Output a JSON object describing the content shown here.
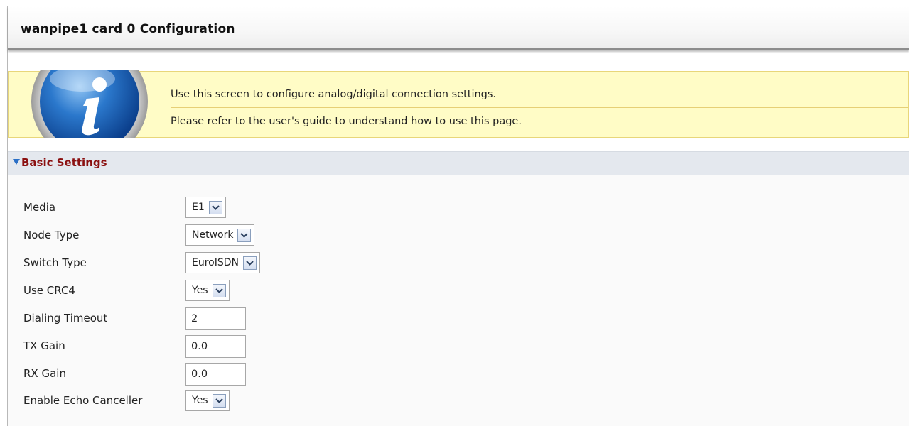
{
  "page": {
    "title": "wanpipe1 card 0 Configuration"
  },
  "info": {
    "icon": "info-icon",
    "line1": "Use this screen to configure analog/digital connection settings.",
    "line2": "Please refer to the user's guide to understand how to use this page."
  },
  "section": {
    "title": "Basic Settings",
    "icon": "triangle-down-icon",
    "accent": "#8b1010"
  },
  "fields": {
    "media": {
      "label": "Media",
      "value": "E1"
    },
    "node_type": {
      "label": "Node Type",
      "value": "Network"
    },
    "switch_type": {
      "label": "Switch Type",
      "value": "EuroISDN"
    },
    "use_crc4": {
      "label": "Use CRC4",
      "value": "Yes"
    },
    "dialing_timeout": {
      "label": "Dialing Timeout",
      "value": "2"
    },
    "tx_gain": {
      "label": "TX Gain",
      "value": "0.0"
    },
    "rx_gain": {
      "label": "RX Gain",
      "value": "0.0"
    },
    "echo_canceller": {
      "label": "Enable Echo Canceller",
      "value": "Yes"
    }
  },
  "colors": {
    "info_bg": "#fffcc6",
    "section_bg": "#e4e8ee",
    "arrow": "#2a6fc6"
  }
}
